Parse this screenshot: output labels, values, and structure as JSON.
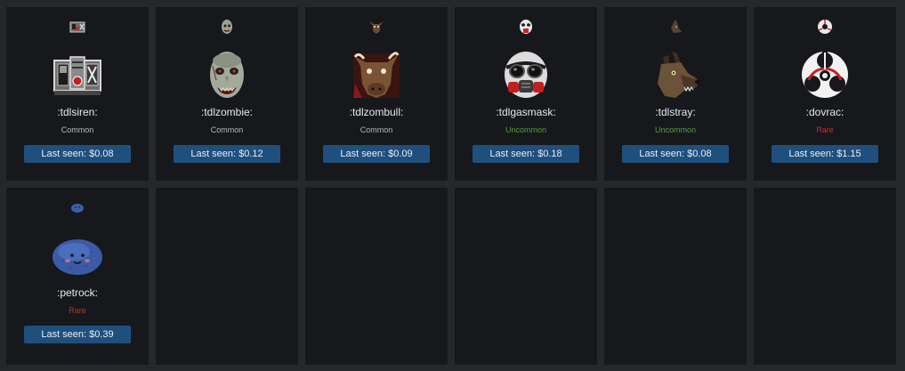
{
  "items": [
    {
      "name": ":tdlsiren:",
      "rarity": "Common",
      "rarity_color": "#b5b8bc",
      "price_label": "Last seen: $0.08",
      "icon": "siren-icon"
    },
    {
      "name": ":tdlzombie:",
      "rarity": "Common",
      "rarity_color": "#b5b8bc",
      "price_label": "Last seen: $0.12",
      "icon": "zombie-icon"
    },
    {
      "name": ":tdlzombull:",
      "rarity": "Common",
      "rarity_color": "#b5b8bc",
      "price_label": "Last seen: $0.09",
      "icon": "zombull-icon"
    },
    {
      "name": ":tdlgasmask:",
      "rarity": "Uncommon",
      "rarity_color": "#5b9a45",
      "price_label": "Last seen: $0.18",
      "icon": "gasmask-icon"
    },
    {
      "name": ":tdlstray:",
      "rarity": "Uncommon",
      "rarity_color": "#5b9a45",
      "price_label": "Last seen: $0.08",
      "icon": "stray-dog-icon"
    },
    {
      "name": ":dovrac:",
      "rarity": "Rare",
      "rarity_color": "#c0302f",
      "price_label": "Last seen: $1.15",
      "icon": "biohazard-icon"
    },
    {
      "name": ":petrock:",
      "rarity": "Rare",
      "rarity_color": "#c0302f",
      "price_label": "Last seen: $0.39",
      "icon": "pet-rock-icon"
    }
  ]
}
